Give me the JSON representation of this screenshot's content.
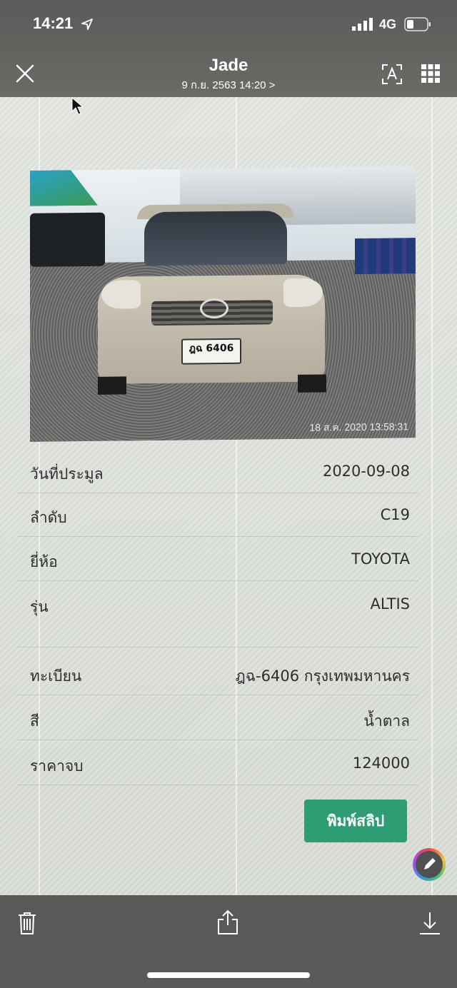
{
  "status_bar": {
    "time": "14:21",
    "network": "4G"
  },
  "header": {
    "title": "Jade",
    "subtitle": "9 ก.ย. 2563 14:20 >"
  },
  "photo": {
    "timestamp": "18 ส.ค. 2020 13:58:31",
    "plate": "ฎฉ 6406"
  },
  "details": [
    {
      "label": "วันที่ประมูล",
      "value": "2020-09-08"
    },
    {
      "label": "ลำดับ",
      "value": "C19"
    },
    {
      "label": "ยี่ห้อ",
      "value": "TOYOTA"
    },
    {
      "label": "รุ่น",
      "value": "ALTIS"
    },
    {
      "label": "ทะเบียน",
      "value": "ฎฉ-6406 กรุงเทพมหานคร"
    },
    {
      "label": "สี",
      "value": "น้ำตาล"
    },
    {
      "label": "ราคาจบ",
      "value": "124000"
    }
  ],
  "print_button": "พิมพ์สลิป",
  "colors": {
    "accent": "#2e9d74",
    "toolbar": "#595957"
  },
  "icons": [
    "close-icon",
    "live-text-icon",
    "grid-icon",
    "markup-icon",
    "trash-icon",
    "share-icon",
    "download-icon"
  ]
}
